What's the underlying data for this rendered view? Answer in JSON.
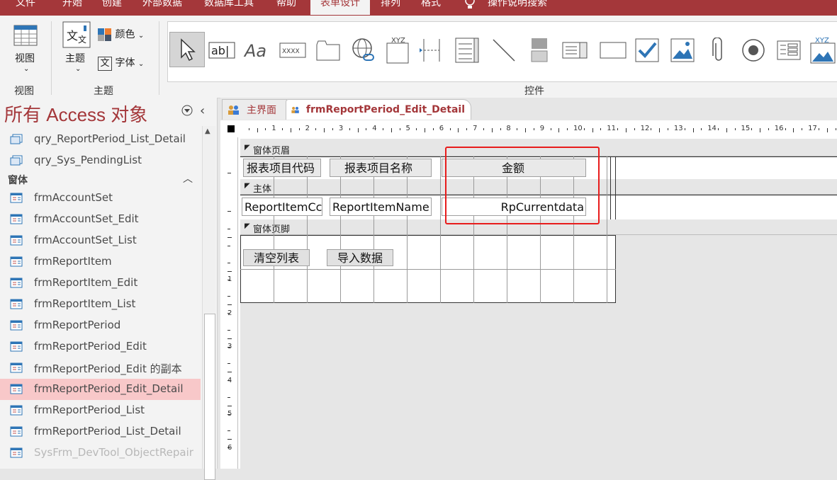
{
  "menu": {
    "items": [
      "文件",
      "开始",
      "创建",
      "外部数据",
      "数据库工具",
      "帮助",
      "表单设计",
      "排列",
      "格式"
    ],
    "active_index": 6,
    "tell_me": "操作说明搜索"
  },
  "ribbon": {
    "views": {
      "button_label": "视图",
      "group_label": "视图"
    },
    "theme": {
      "button_label": "主题",
      "colors_label": "颜色",
      "fonts_label": "字体",
      "group_label": "主题"
    },
    "controls": {
      "group_label": "控件",
      "items": [
        "select-pointer",
        "text-box",
        "label",
        "button",
        "tab-control",
        "hyperlink",
        "navigation-control",
        "option-group",
        "page-break",
        "combo-box",
        "line",
        "toggle-button",
        "list-box",
        "rectangle",
        "check-box",
        "unbound-object-frame",
        "attachment",
        "option-button",
        "subform",
        "bound-object-frame"
      ],
      "button_text": "XXXX",
      "xyz_text": "XYZ"
    }
  },
  "nav": {
    "title": "所有 Access 对象",
    "section_forms": "窗体",
    "queries": [
      "qry_ReportPeriod_List_Detail",
      "qry_Sys_PendingList"
    ],
    "forms": [
      "frmAccountSet",
      "frmAccountSet_Edit",
      "frmAccountSet_List",
      "frmReportItem",
      "frmReportItem_Edit",
      "frmReportItem_List",
      "frmReportPeriod",
      "frmReportPeriod_Edit",
      "frmReportPeriod_Edit 的副本",
      "frmReportPeriod_Edit_Detail",
      "frmReportPeriod_List",
      "frmReportPeriod_List_Detail",
      "SysFrm_DevTool_ObjectRepair"
    ],
    "active_form": "frmReportPeriod_Edit_Detail"
  },
  "tabs": [
    {
      "label": "主界面",
      "current": false
    },
    {
      "label": "frmReportPeriod_Edit_Detail",
      "current": true
    }
  ],
  "ruler_numbers": [
    "1",
    "2",
    "3",
    "4",
    "5",
    "6",
    "7",
    "8",
    "9",
    "10",
    "11",
    "12",
    "13",
    "14",
    "15",
    "16",
    "17"
  ],
  "left_ruler_numbers": [
    "1",
    "2",
    "3",
    "4",
    "5",
    "6"
  ],
  "form": {
    "header_section": "窗体页眉",
    "detail_section": "主体",
    "footer_section": "窗体页脚",
    "header_labels": [
      "报表项目代码",
      "报表项目名称",
      "金额"
    ],
    "detail_fields": [
      "ReportItemCc",
      "ReportItemName",
      "RpCurrentdata"
    ],
    "footer_buttons": [
      "清空列表",
      "导入数据"
    ]
  },
  "colors": {
    "accent": "#a4373a",
    "highlight": "#e81c1c",
    "active_nav": "#f8c8c9"
  }
}
